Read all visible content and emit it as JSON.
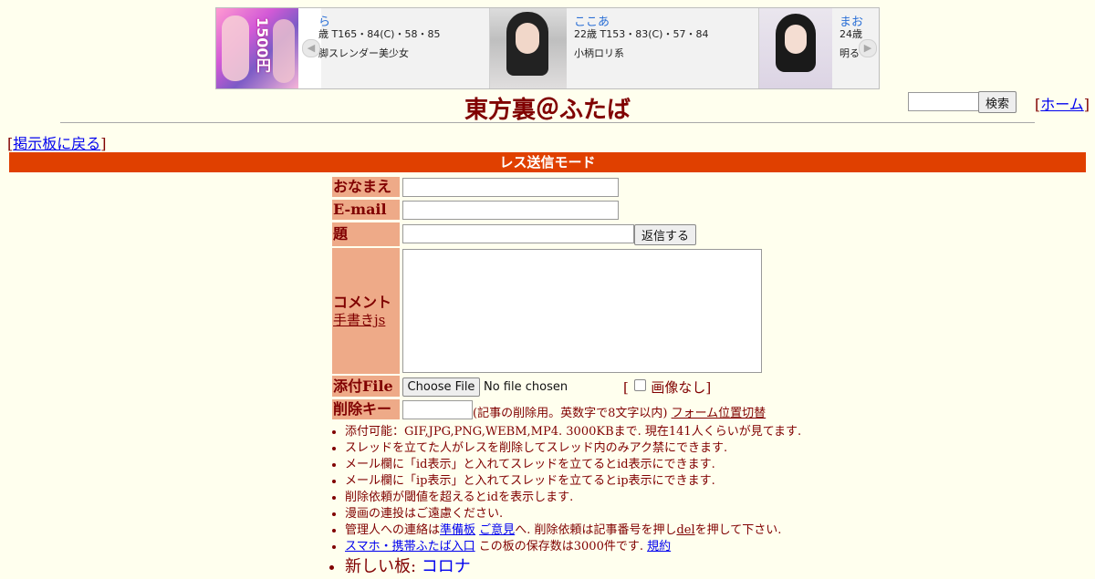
{
  "banner": {
    "left_name_partial": "ら",
    "left_stats_partial": "歳 T165・84(C)・58・85",
    "left_desc_partial": "脚スレンダー美少女",
    "promo_text": "1500円",
    "cards": [
      {
        "name": "ここあ",
        "stats": "22歳 T153・83(C)・57・84",
        "desc": "小柄ロリ系"
      },
      {
        "name": "まお",
        "stats": "24歳",
        "desc": "明る"
      }
    ],
    "prev_arrow": "◀",
    "next_arrow": "▶"
  },
  "header": {
    "title": "東方裏＠ふたば",
    "search_button": "検索",
    "home_link": "ホーム"
  },
  "back_link": "掲示板に戻る",
  "mode_bar": "レス送信モード",
  "form": {
    "name_label": "おなまえ",
    "email_label": "E-mail",
    "subject_label": "題　名",
    "submit_button": "返信する",
    "comment_label": "コメント",
    "handwrite_link": "手書きjs",
    "file_label": "添付File",
    "choose_file_button": "Choose File",
    "no_file_text": "No file chosen",
    "no_image_label": "画像なし",
    "delete_key_label": "削除キー",
    "delete_key_note": "(記事の削除用。英数字で8文字以内)",
    "form_position_link": "フォーム位置切替"
  },
  "notes": {
    "n1": "添付可能：GIF,JPG,PNG,WEBM,MP4. 3000KBまで. 現在141人くらいが見てます.",
    "n2": "スレッドを立てた人がレスを削除してスレッド内のみアク禁にできます.",
    "n3": "メール欄に「id表示」と入れてスレッドを立てるとid表示にできます.",
    "n4": "メール欄に「ip表示」と入れてスレッドを立てるとip表示にできます.",
    "n5": "削除依頼が閾値を超えるとidを表示します.",
    "n6": "漫画の連投はご遠慮ください.",
    "n7_pre": "管理人への連絡は",
    "n7_link1": "準備板",
    "n7_link2": "ご意見",
    "n7_mid": "へ. 削除依頼は記事番号を押し",
    "n7_link3": "del",
    "n7_post": "を押して下さい.",
    "n8_link": "スマホ・携帯ふたば入口",
    "n8_text": " この板の保存数は3000件です.",
    "n8_link2": "規約",
    "n9_label": "新しい板: ",
    "n9_link": "コロナ"
  },
  "colors": {
    "background": "#ffffee",
    "text": "#800000",
    "mode_bar": "#e04000",
    "label_bg": "#eeaa88"
  }
}
